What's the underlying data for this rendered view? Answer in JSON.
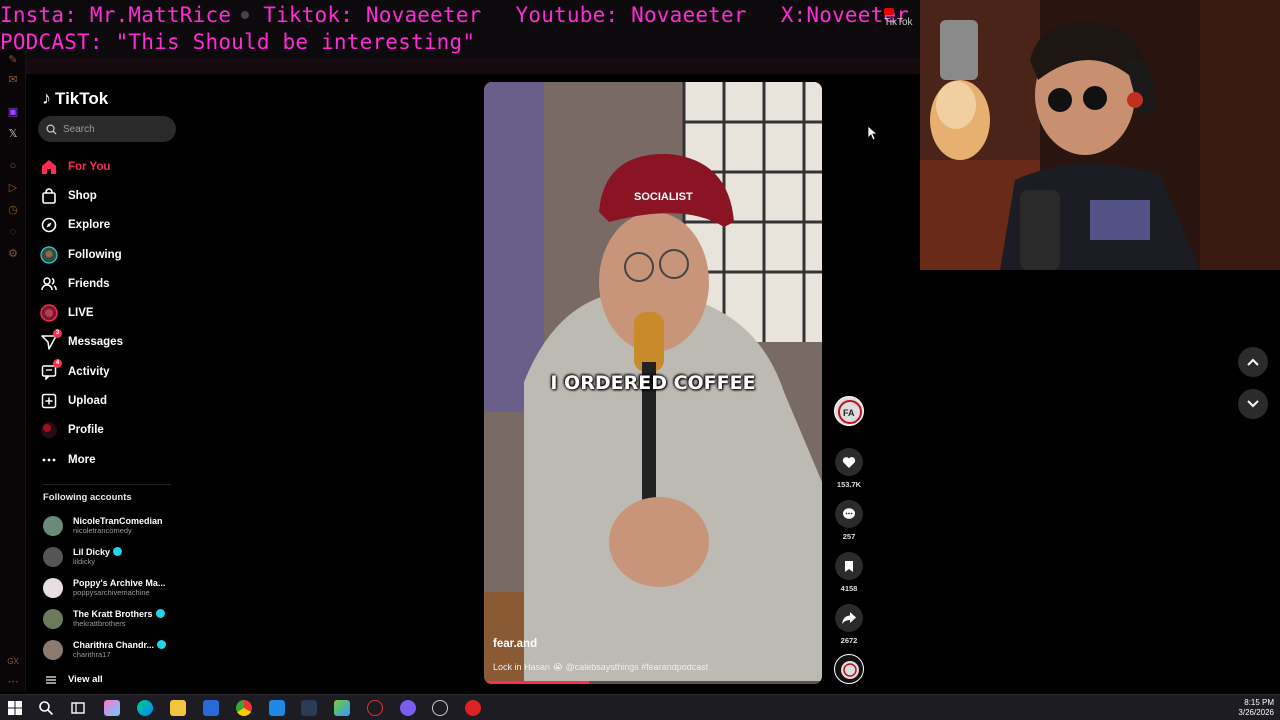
{
  "overlay": {
    "line1": {
      "insta": "Insta: Mr.MattRice",
      "tiktok": "Tiktok: Novaeeter",
      "youtube": "Youtube: Novaeeter",
      "x": "X:Noveeter"
    },
    "line2": "PODCAST: \"This Should be interesting\"",
    "browser_tab": "TikTok",
    "color": "#ff2bd6"
  },
  "tiktok": {
    "logo": "TikTok",
    "search_placeholder": "Search",
    "nav": [
      {
        "label": "For You",
        "icon": "home-icon",
        "active": true
      },
      {
        "label": "Shop",
        "icon": "shopping-bag-icon"
      },
      {
        "label": "Explore",
        "icon": "compass-icon"
      },
      {
        "label": "Following",
        "icon": "following-avatar-icon"
      },
      {
        "label": "Friends",
        "icon": "friends-icon"
      },
      {
        "label": "LIVE",
        "icon": "live-icon"
      },
      {
        "label": "Messages",
        "icon": "messages-icon",
        "badge": "3"
      },
      {
        "label": "Activity",
        "icon": "activity-icon",
        "badge": "4"
      },
      {
        "label": "Upload",
        "icon": "upload-icon"
      },
      {
        "label": "Profile",
        "icon": "profile-icon"
      },
      {
        "label": "More",
        "icon": "more-icon"
      }
    ],
    "following_header": "Following accounts",
    "accounts": [
      {
        "name": "NicoleTranComedian",
        "handle": "nicoletrancomedy",
        "verified": false,
        "color": "#6a8a7a"
      },
      {
        "name": "Lil Dicky",
        "handle": "lildicky",
        "verified": true,
        "color": "#555555"
      },
      {
        "name": "Poppy's Archive Ma...",
        "handle": "poppysarchivemachine",
        "verified": false,
        "color": "#e8e0e0"
      },
      {
        "name": "The Kratt Brothers",
        "handle": "thekrattbrothers",
        "verified": true,
        "color": "#6a7a5a"
      },
      {
        "name": "Charithra Chandr...",
        "handle": "charithra17",
        "verified": true,
        "color": "#8a7a70"
      }
    ],
    "view_all": "View all",
    "accent": "#fe2c55"
  },
  "video": {
    "caption": "I ORDERED COFFEE",
    "author": "fear.and",
    "description": "Lock in Hasan 😭 @calebsaysthings #fearandpodcast",
    "progress": 0.31
  },
  "actions": {
    "likes": "153.7K",
    "comments": "257",
    "saves": "4158",
    "shares": "2672"
  },
  "taskbar": {
    "time": "8:15 PM",
    "date": "3/26/2026"
  }
}
